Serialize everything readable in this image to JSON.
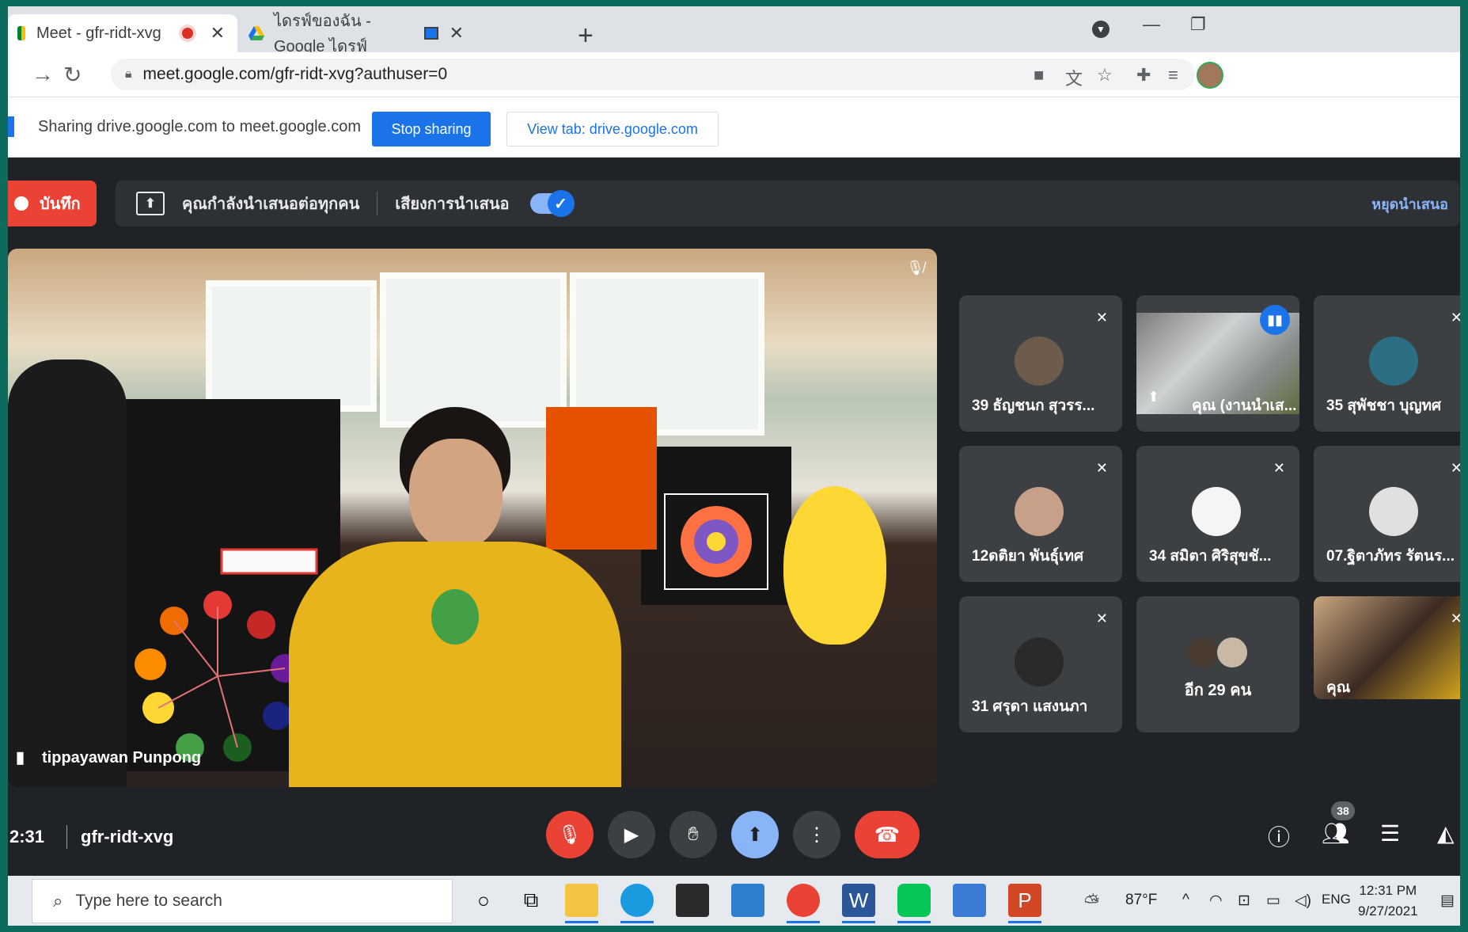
{
  "browser": {
    "tabs": [
      {
        "title": "Meet - gfr-ridt-xvg",
        "active": true,
        "recording": true
      },
      {
        "title": "ไดรฟ์ของฉัน - Google ไดรฟ์",
        "active": false,
        "sharing": true
      }
    ],
    "new_tab_symbol": "+",
    "url": "meet.google.com/gfr-ridt-xvg?authuser=0"
  },
  "share_bar": {
    "text": "Sharing drive.google.com to meet.google.com",
    "stop_label": "Stop sharing",
    "view_label": "View tab: drive.google.com"
  },
  "meet_top": {
    "record_label": "บันทึก",
    "presenting_text": "คุณกำลังนำเสนอต่อทุกคน",
    "audio_label": "เสียงการนำเสนอ",
    "audio_on": true,
    "stop_presenting": "หยุดนำเสนอ"
  },
  "main_video": {
    "name": "tippayawan Punpong"
  },
  "tiles": [
    {
      "name": "39 ธัญชนก สุวรร..."
    },
    {
      "name": "คุณ (งานนำเส...",
      "speaking": true
    },
    {
      "name": "35 สุพัชชา บุญทศ"
    },
    {
      "name": "12ดติยา พันธุ์เทศ"
    },
    {
      "name": "34 สมิตา ศิริสุขชั..."
    },
    {
      "name": "07.ฐิตาภัทร รัตนร..."
    },
    {
      "name": "31 ศรุดา แสงนภา"
    },
    {
      "name": "อีก 29 คน"
    },
    {
      "name": "คุณ"
    }
  ],
  "meet_bottom": {
    "time": "2:31",
    "code": "gfr-ridt-xvg",
    "participants_count": "38"
  },
  "taskbar": {
    "search_placeholder": "Type here to search",
    "weather": "87°F",
    "lang": "ENG",
    "time": "12:31 PM",
    "date": "9/27/2021"
  },
  "colors": {
    "meet_bg": "#1f2226",
    "accent_blue": "#1a73e8",
    "end_red": "#ea4335",
    "presenting_blue": "#8ab4f8"
  }
}
